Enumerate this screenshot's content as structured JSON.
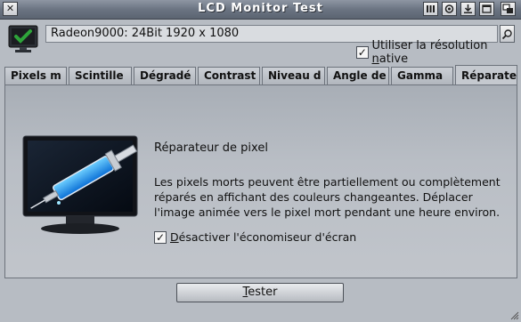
{
  "window": {
    "title": "LCD Monitor Test",
    "close_glyph": "✕",
    "right_buttons": [
      "iconify",
      "snapshot",
      "jump",
      "zoom",
      "depth"
    ]
  },
  "display": {
    "label": "Radeon9000: 24Bit 1920 x 1080",
    "popup_glyph": "⌕"
  },
  "native_resolution": {
    "label_prefix": "Utiliser la résolution ",
    "label_accesskey": "n",
    "label_suffix": "ative",
    "checked": true
  },
  "tabs": [
    {
      "label": "Pixels m",
      "active": false
    },
    {
      "label": "Scintille",
      "active": false
    },
    {
      "label": "Dégradé",
      "active": false
    },
    {
      "label": "Contrast",
      "active": false
    },
    {
      "label": "Niveau d",
      "active": false
    },
    {
      "label": "Angle de",
      "active": false
    },
    {
      "label": "Gamma",
      "active": false
    },
    {
      "label": "Réparate",
      "active": true
    }
  ],
  "repair": {
    "heading": "Réparateur de pixel",
    "description": "Les pixels morts peuvent être partiellement ou complètement réparés en affichant des couleurs changeantes. Déplacer l'image animée vers le pixel mort pendant une heure environ.",
    "screensaver_accesskey": "D",
    "screensaver_rest": "ésactiver l'économiseur d'écran",
    "screensaver_checked": true
  },
  "actions": {
    "test_accesskey": "T",
    "test_rest": "ester"
  },
  "colors": {
    "accent_blue": "#1e90ff",
    "check_green": "#2ea43a"
  }
}
